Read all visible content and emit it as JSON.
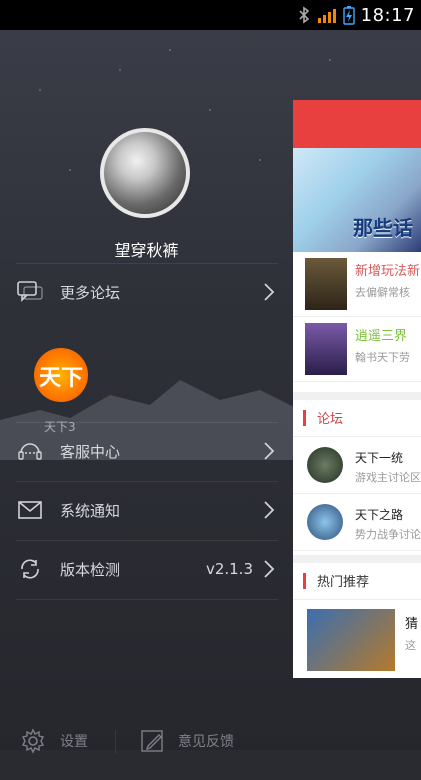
{
  "status_bar": {
    "time": "18:17",
    "icons": [
      "bluetooth-icon",
      "signal-icon",
      "battery-charging-icon"
    ]
  },
  "profile": {
    "username": "望穿秋裤"
  },
  "menu": {
    "more_forums": "更多论坛",
    "forum_shortcut": "天下3",
    "forum_shortcut_logo_text": "天下",
    "customer_service": "客服中心",
    "system_notice": "系统通知",
    "version_check": "版本检测",
    "version_value": "v2.1.3"
  },
  "bottom_bar": {
    "settings": "设置",
    "feedback": "意见反馈"
  },
  "right_panel": {
    "banner_text": "那些话",
    "news": [
      {
        "title": "新增玩法新",
        "subtitle": "去偏僻常核"
      },
      {
        "title": "逍遥三界",
        "subtitle": "翰书天下劳"
      }
    ],
    "section_forum": "论坛",
    "forums": [
      {
        "title": "天下一统",
        "subtitle": "游戏主讨论区"
      },
      {
        "title": "天下之路",
        "subtitle": "势力战争讨论"
      }
    ],
    "section_hot": "热门推荐",
    "hot": [
      {
        "title": "猜",
        "subtitle": "这"
      }
    ]
  },
  "colors": {
    "accent_red": "#e83f3f",
    "drawer_bg": "#2e3038"
  }
}
